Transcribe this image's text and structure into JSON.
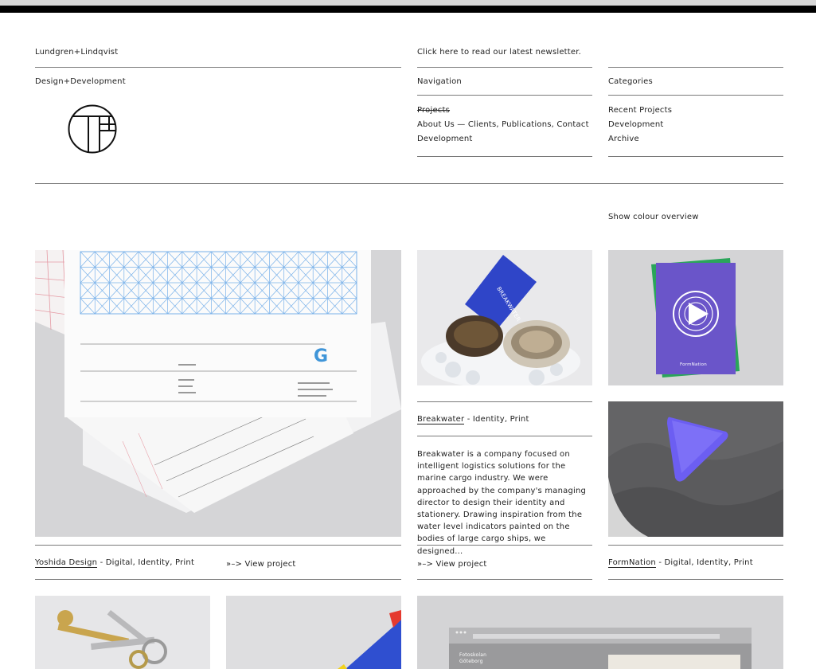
{
  "header": {
    "brand": "Lundgren+Lindqvist",
    "tagline": "Design+Development",
    "newsletter": "Click here to read our latest newsletter."
  },
  "nav": {
    "heading": "Navigation",
    "projects": "Projects",
    "about_line": "About Us — Clients, Publications, Contact",
    "development": "Development"
  },
  "categories": {
    "heading": "Categories",
    "items": [
      "Recent Projects",
      "Development",
      "Archive"
    ]
  },
  "colour_overview": "Show colour overview",
  "projects": [
    {
      "name": "Yoshida Design",
      "tags": " - Digital, Identity, Print",
      "view": "View project"
    },
    {
      "name": "Breakwater",
      "tags": " - Identity, Print",
      "view": "View project",
      "description": "Breakwater is a company focused on intelligent logistics solutions for the marine cargo industry. We were approached by the company's managing director to design their identity and stationery. Drawing inspiration from the water level indicators painted on the bodies of large cargo ships, we designed..."
    },
    {
      "name": "FormNation",
      "tags": " - Digital, Identity, Print"
    }
  ],
  "view_arrow": "»–>",
  "thumb_text": {
    "breakwater_card": "BREAKWATER",
    "formnation_card": "FormNation",
    "fotoskolan": "Fotoskolan\nGöteborg"
  },
  "colors": {
    "accent_blue": "#2f45c8",
    "purple": "#6a55c9",
    "green": "#2aa55a",
    "rule": "#7a7a7a"
  }
}
